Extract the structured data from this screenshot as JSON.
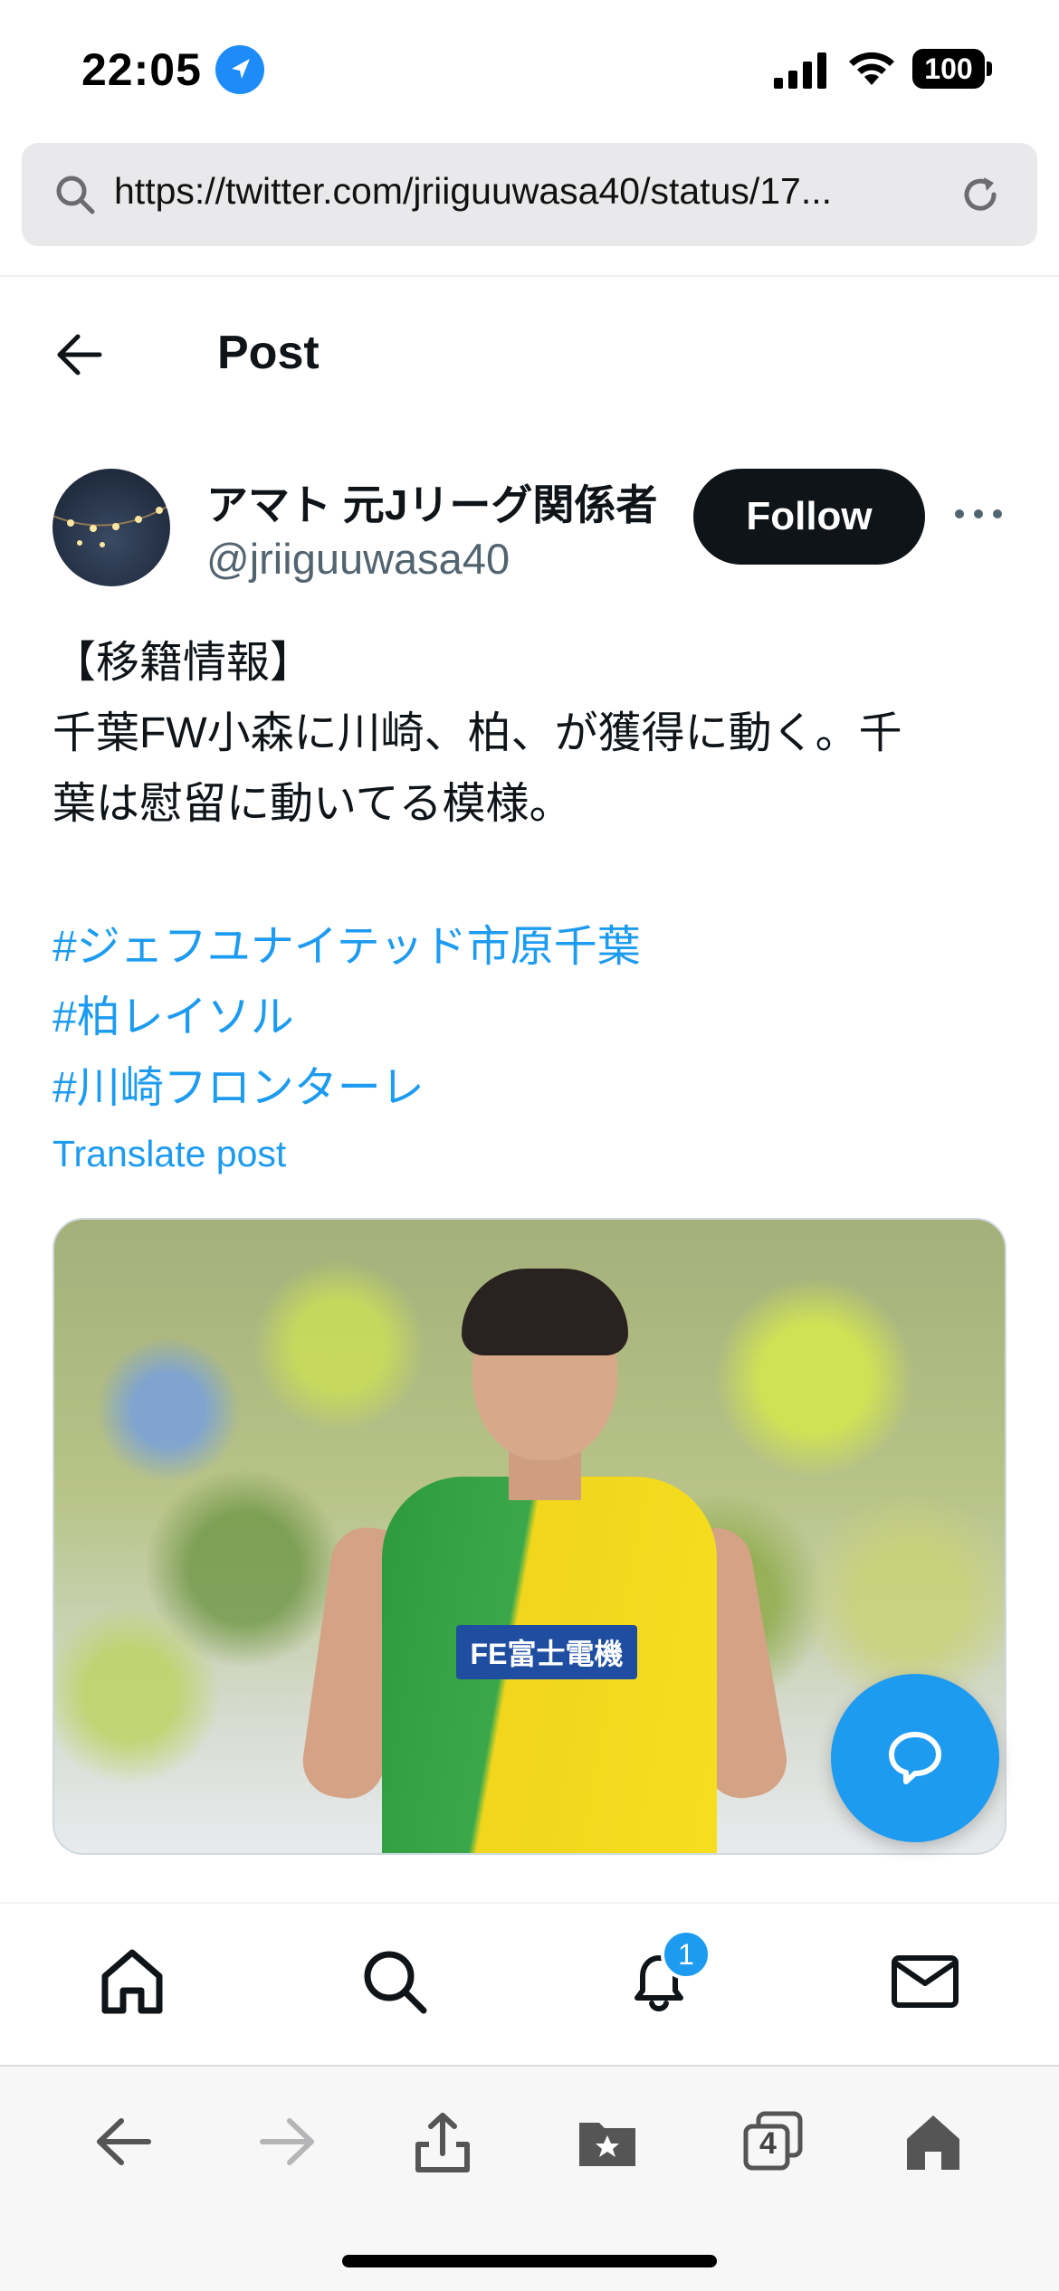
{
  "status_bar": {
    "time": "22:05",
    "battery": "100"
  },
  "browser": {
    "url": "https://twitter.com/jriiguuwasa40/status/17..."
  },
  "header": {
    "title": "Post"
  },
  "author": {
    "display_name": "アマト 元Jリーグ関係者",
    "handle": "@jriiguuwasa40",
    "follow_label": "Follow"
  },
  "tweet": {
    "lines": [
      "【移籍情報】",
      "千葉FW小森に川崎、柏、が獲得に動く。千",
      "葉は慰留に動いてる模様。"
    ],
    "hashtags": [
      "#ジェフユナイテッド市原千葉",
      "#柏レイソル",
      "#川崎フロンターレ"
    ],
    "translate_label": "Translate post",
    "media_sponsor": "FE富士電機"
  },
  "tab_bar": {
    "notification_count": "1"
  },
  "safari": {
    "tab_count": "4"
  },
  "colors": {
    "accent": "#1d9bf0",
    "text": "#0f1419",
    "secondary": "#536471"
  }
}
